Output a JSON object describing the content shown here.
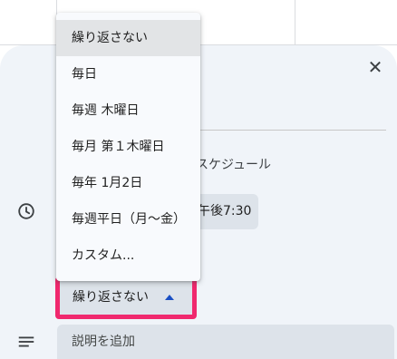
{
  "dialog": {
    "timezone_text": "スケジュール",
    "time_chip": "午後7:30",
    "repeat_value": "繰り返さない",
    "description_placeholder": "説明を追加"
  },
  "menu": {
    "items": [
      {
        "label": "繰り返さない",
        "selected": true
      },
      {
        "label": "毎日",
        "selected": false
      },
      {
        "label": "毎週 木曜日",
        "selected": false
      },
      {
        "label": "毎月 第１木曜日",
        "selected": false
      },
      {
        "label": "毎年 1月2日",
        "selected": false
      },
      {
        "label": "毎週平日（月～金）",
        "selected": false
      },
      {
        "label": "カスタム...",
        "selected": false
      }
    ]
  },
  "icons": {
    "close": "close-icon",
    "clock": "clock-icon",
    "notes": "notes-icon",
    "arrow": "arrow-up-icon"
  },
  "colors": {
    "highlight": "#f0286e",
    "arrow": "#1a4fc4",
    "dialog_bg": "#f0f4f9"
  }
}
